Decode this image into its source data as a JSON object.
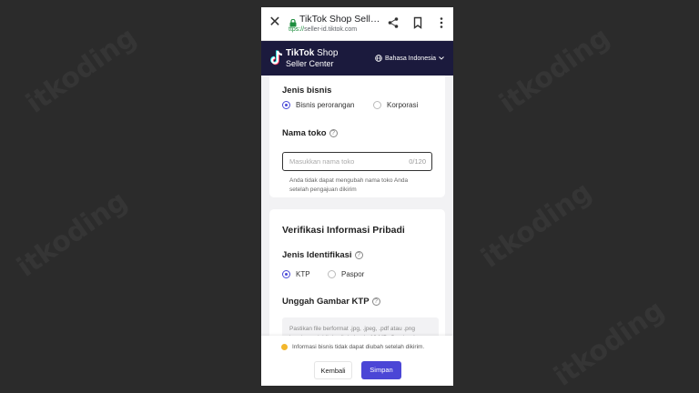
{
  "browser": {
    "page_title": "TikTok Shop Selle...",
    "url_scheme": "ttps://",
    "url_host": "seller-id.tiktok.com"
  },
  "header": {
    "brand_line1_bold": "TikTok",
    "brand_line1_rest": " Shop",
    "brand_line2": "Seller Center",
    "language": "Bahasa Indonesia"
  },
  "business": {
    "type_label": "Jenis bisnis",
    "options": [
      "Bisnis perorangan",
      "Korporasi"
    ],
    "selected": "Bisnis perorangan",
    "store_name_label": "Nama toko",
    "store_name_placeholder": "Masukkan nama toko",
    "store_name_counter": "0/120",
    "store_name_hint": "Anda tidak dapat mengubah nama toko Anda setelah pengajuan dikirim"
  },
  "identity": {
    "section_title": "Verifikasi Informasi Pribadi",
    "id_type_label": "Jenis Identifikasi",
    "options": [
      "KTP",
      "Paspor"
    ],
    "selected": "KTP",
    "upload_label": "Unggah Gambar KTP",
    "upload_note": "Pastikan file berformat .jpg, .jpeg, .pdf atau .png berukuran lebih kecil daripada 10 MB. Gambar harus jelas dan menampilkan semua informasi"
  },
  "footer": {
    "warning": "Informasi bisnis tidak dapat diubah setelah dikirim.",
    "back_label": "Kembali",
    "save_label": "Simpan"
  },
  "watermark": "itkoding",
  "colors": {
    "brand_bg": "#1b1a3d",
    "accent": "#4b46d6",
    "warning_dot": "#f3b72c"
  }
}
